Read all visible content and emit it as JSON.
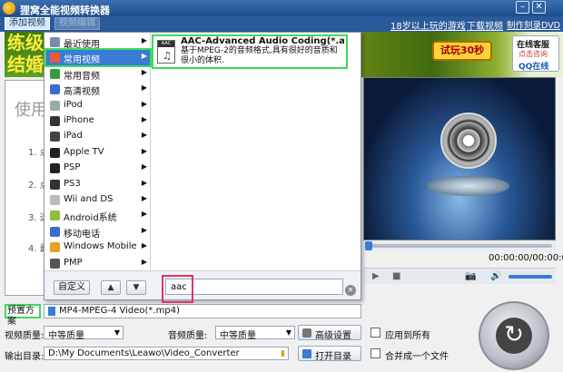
{
  "window": {
    "title": "狸窝全能视频转换器"
  },
  "toolbar": {
    "add_video": "添加视频",
    "video_edit": "视频编辑",
    "links": [
      "18岁以上玩的游戏",
      "下载视频",
      "制作刻录DVD"
    ]
  },
  "ad": {
    "promo": "试玩30秒",
    "online_service": "在线客服",
    "online_sub": "点击咨询",
    "qq_online": "QQ在线"
  },
  "left_panel": {
    "heading": "使用",
    "big_text": [
      "练级",
      "结婚"
    ],
    "steps": [
      "1. 点",
      "2. 点",
      "3. 选",
      "4. 最"
    ]
  },
  "menu": {
    "categories": [
      {
        "label": "最近使用",
        "icon": "clock-icon",
        "color": "#7a8aa8"
      },
      {
        "label": "常用视频",
        "icon": "film-icon",
        "color": "#e85a3a"
      },
      {
        "label": "常用音频",
        "icon": "audio-icon",
        "color": "#3a9a3a"
      },
      {
        "label": "高清视频",
        "icon": "hd-icon",
        "color": "#3a6ad5"
      },
      {
        "label": "iPod",
        "icon": "ipod-icon",
        "color": "#9aa"
      },
      {
        "label": "iPhone",
        "icon": "iphone-icon",
        "color": "#333"
      },
      {
        "label": "iPad",
        "icon": "ipad-icon",
        "color": "#444"
      },
      {
        "label": "Apple TV",
        "icon": "apple-tv-icon",
        "color": "#222"
      },
      {
        "label": "PSP",
        "icon": "psp-icon",
        "color": "#222"
      },
      {
        "label": "PS3",
        "icon": "ps3-icon",
        "color": "#333"
      },
      {
        "label": "Wii and DS",
        "icon": "wii-icon",
        "color": "#bbb"
      },
      {
        "label": "Android系统",
        "icon": "android-icon",
        "color": "#8ac03a"
      },
      {
        "label": "移动电话",
        "icon": "mobile-phone-icon",
        "color": "#3a6ad5"
      },
      {
        "label": "Windows Mobile",
        "icon": "windows-mobile-icon",
        "color": "#e8a020"
      },
      {
        "label": "PMP",
        "icon": "pmp-icon",
        "color": "#555"
      }
    ],
    "format": {
      "icon_tag": "AAC",
      "name": "AAC-Advanced Audio Coding(*.aac)",
      "description": "基于MPEG-2的音频格式,具有很好的音质和很小的体积."
    },
    "custom_button": "自定义",
    "search_value": "aac"
  },
  "player": {
    "time": "00:00:00/00:00:00"
  },
  "settings": {
    "preset_label": "预置方案",
    "preset_value": "MP4-MPEG-4 Video(*.mp4)",
    "video_quality_label": "视频质量:",
    "video_quality_value": "中等质量",
    "audio_quality_label": "音频质量:",
    "audio_quality_value": "中等质量",
    "advanced_button": "高级设置",
    "apply_all_label": "应用到所有",
    "output_label": "输出目录:",
    "output_path": "D:\\My Documents\\Leawo\\Video_Converter",
    "open_dir_button": "打开目录",
    "merge_label": "合并成一个文件"
  }
}
